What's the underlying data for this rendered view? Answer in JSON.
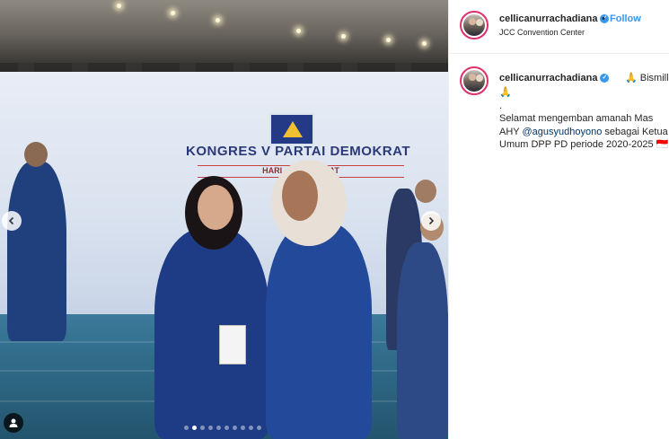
{
  "post": {
    "username": "cellicanurrachadiana",
    "verified_icon": "verified-badge-icon",
    "follow_separator": "•",
    "follow_label": "Follow",
    "location": "JCC Convention Center"
  },
  "photo": {
    "banner_text": "KONGRES V PARTAI DEMOKRAT",
    "banner_sub": "HARI ... DEMOKRAT",
    "carousel_dots_total": 10,
    "carousel_dot_active": 1
  },
  "caption": {
    "username": "cellicanurrachadiana",
    "first_line_rest": "🙏 Bismillah",
    "line2": "🙏",
    "line3": ".",
    "line4": "Selamat mengemban amanah Mas",
    "line5_pre": "AHY ",
    "mention": "@agusyudhoyono",
    "line5_post": " sebagai Ketua",
    "line6": "Umum DPP PD periode 2020-2025 🇮🇩"
  },
  "colors": {
    "accent": "#3897f0",
    "mention": "#00376b",
    "story_ring": "#e0306a"
  }
}
